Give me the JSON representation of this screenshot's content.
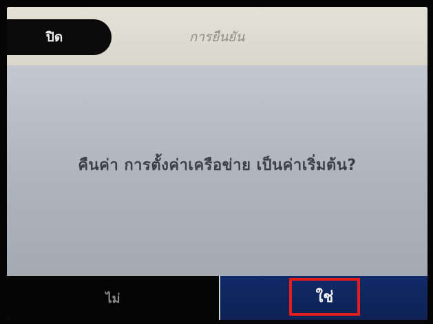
{
  "header": {
    "close_label": "ปิด",
    "title": "การยืนยัน"
  },
  "dialog": {
    "message": "คืนค่า การตั้งค่าเครือข่าย เป็นค่าเริ่มต้น?"
  },
  "footer": {
    "no_label": "ไม่",
    "yes_label": "ใช่"
  },
  "colors": {
    "header_bg": "#e0ddd2",
    "body_bg": "#b2b7c0",
    "close_button_bg": "#0b0b0b",
    "no_button_bg": "#050505",
    "yes_button_bg": "#102760",
    "highlight_border": "#e21d1d"
  }
}
